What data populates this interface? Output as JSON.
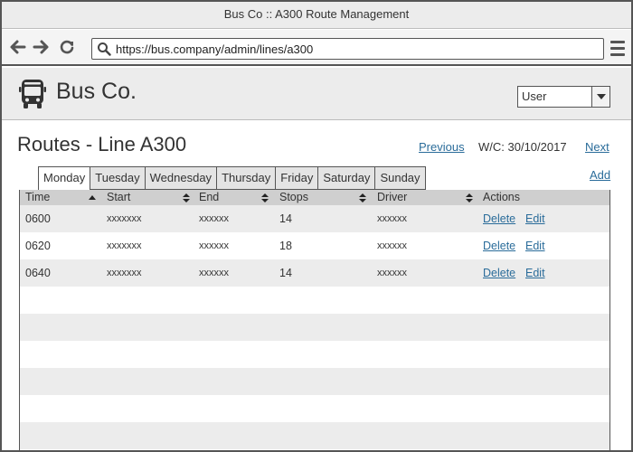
{
  "browser": {
    "title": "Bus Co :: A300 Route Management",
    "url": "https://bus.company/admin/lines/a300"
  },
  "app": {
    "brand": "Bus Co.",
    "user_select": "User"
  },
  "page": {
    "title": "Routes - Line A300",
    "previous": "Previous",
    "week": "W/C: 30/10/2017",
    "next": "Next",
    "add": "Add"
  },
  "tabs": [
    "Monday",
    "Tuesday",
    "Wednesday",
    "Thursday",
    "Friday",
    "Saturday",
    "Sunday"
  ],
  "active_tab": "Monday",
  "table": {
    "columns": [
      "Time",
      "Start",
      "End",
      "Stops",
      "Driver",
      "Actions"
    ],
    "rows": [
      {
        "time": "0600",
        "start": "xxxxxxx",
        "end": "xxxxxx",
        "stops": "14",
        "driver": "xxxxxx",
        "delete": "Delete",
        "edit": "Edit"
      },
      {
        "time": "0620",
        "start": "xxxxxxx",
        "end": "xxxxxx",
        "stops": "18",
        "driver": "xxxxxx",
        "delete": "Delete",
        "edit": "Edit"
      },
      {
        "time": "0640",
        "start": "xxxxxxx",
        "end": "xxxxxx",
        "stops": "14",
        "driver": "xxxxxx",
        "delete": "Delete",
        "edit": "Edit"
      }
    ]
  },
  "colors": {
    "link": "#2a6c9a",
    "header_bg": "#ececec",
    "table_header_bg": "#cfcfcf",
    "row_stripe": "#ececec"
  },
  "icons": [
    "back-arrow-icon",
    "forward-arrow-icon",
    "reload-icon",
    "search-icon",
    "hamburger-menu-icon",
    "bus-icon",
    "dropdown-arrow-icon",
    "sort-asc-icon",
    "sort-both-icon"
  ]
}
